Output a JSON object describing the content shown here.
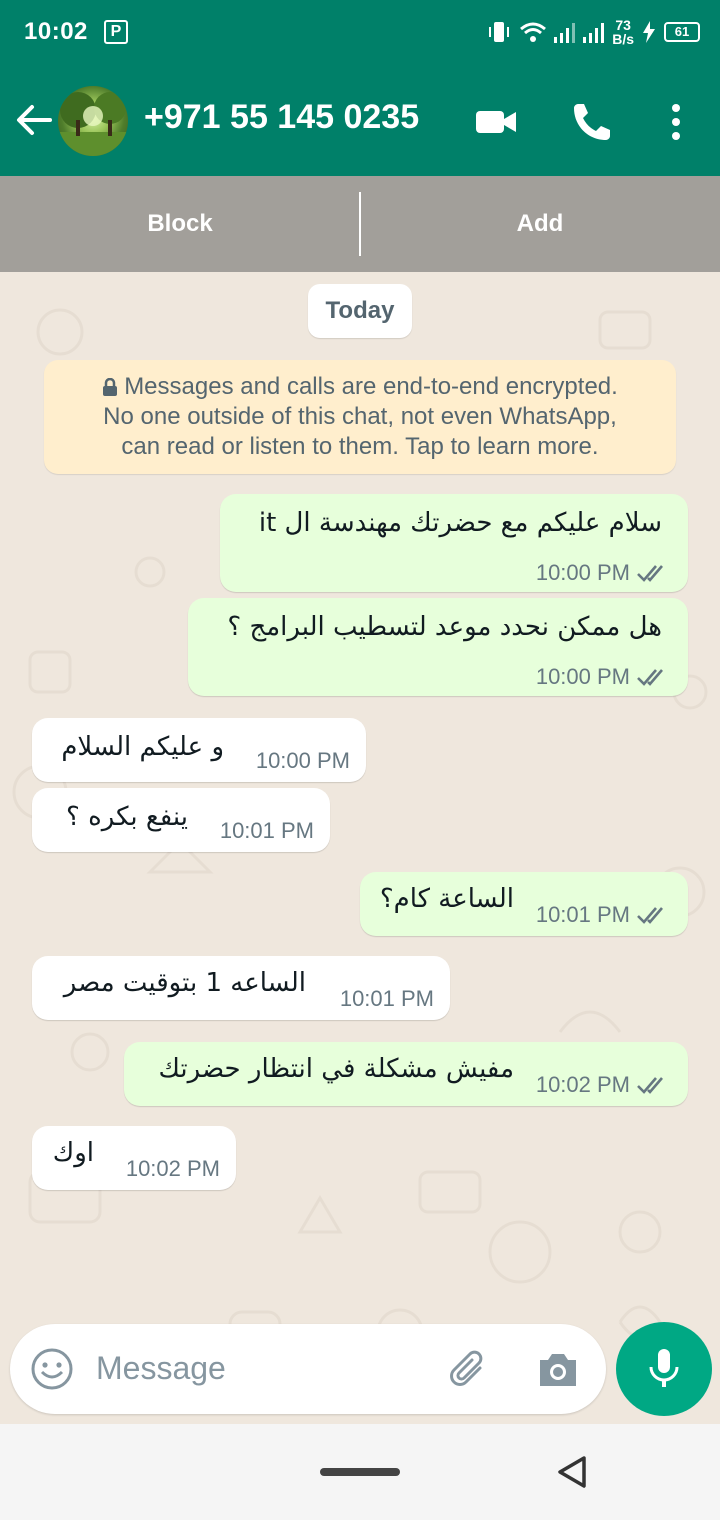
{
  "status_bar": {
    "time": "10:02",
    "pin_label": "P",
    "net_speed_value": "73",
    "net_speed_unit": "B/s",
    "battery": "61"
  },
  "header": {
    "contact_name": "+971 55 145 0235",
    "icons": [
      "back-arrow-icon",
      "video-call-icon",
      "phone-icon",
      "more-options-icon"
    ]
  },
  "actions": {
    "block_label": "Block",
    "add_label": "Add"
  },
  "chat": {
    "day_label": "Today",
    "encryption_notice": {
      "line1": "Messages and calls are end-to-end encrypted.",
      "line2": "No one outside of this chat, not even WhatsApp,",
      "line3": "can read or listen to them. Tap to learn more."
    },
    "messages": [
      {
        "direction": "out",
        "text": "سلام عليكم مع حضرتك مهندسة ال it",
        "time": "10:00 PM",
        "status": "delivered"
      },
      {
        "direction": "out",
        "text": "هل ممكن نحدد موعد لتسطيب البرامج ؟",
        "time": "10:00 PM",
        "status": "delivered"
      },
      {
        "direction": "in",
        "text": "و عليكم السلام",
        "time": "10:00 PM"
      },
      {
        "direction": "in",
        "text": "ينفع بكره ؟",
        "time": "10:01 PM"
      },
      {
        "direction": "out",
        "text": "الساعة كام؟",
        "time": "10:01 PM",
        "status": "delivered"
      },
      {
        "direction": "in",
        "text": "الساعه 1 بتوقيت مصر",
        "time": "10:01 PM"
      },
      {
        "direction": "out",
        "text": "مفيش مشكلة في انتظار حضرتك",
        "time": "10:02 PM",
        "status": "delivered"
      },
      {
        "direction": "in",
        "text": "اوك",
        "time": "10:02 PM"
      }
    ]
  },
  "composer": {
    "placeholder": "Message",
    "icons": [
      "emoji-icon",
      "attach-icon",
      "camera-icon",
      "mic-icon"
    ]
  },
  "colors": {
    "header": "#008069",
    "outgoing_bubble": "#e7ffdb",
    "incoming_bubble": "#ffffff",
    "chat_bg": "#efe7dd",
    "mic_button": "#00a884",
    "read_ticks": "#667781"
  }
}
